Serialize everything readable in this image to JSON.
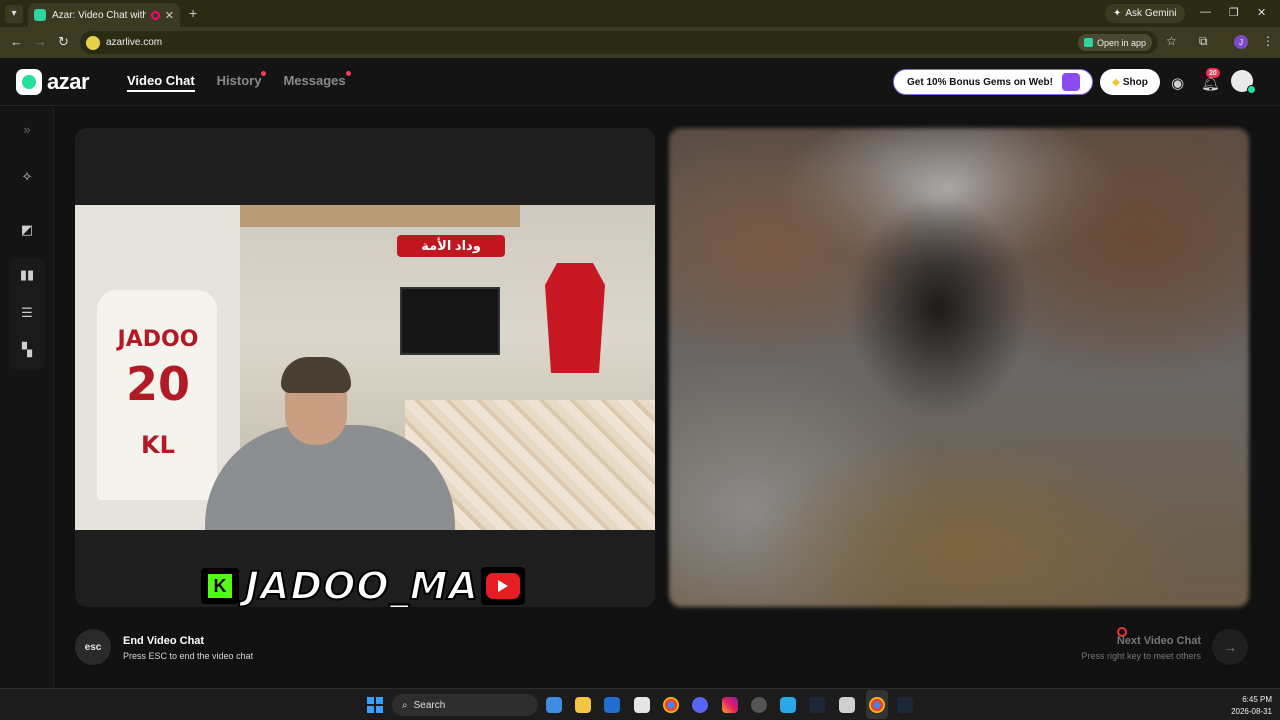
{
  "browser": {
    "tab_title": "Azar: Video Chat with New",
    "url": "azarlive.com",
    "ask_gemini": "Ask Gemini",
    "open_in_app": "Open in app",
    "profile_initial": "J"
  },
  "header": {
    "brand": "azar",
    "nav": [
      "Video Chat",
      "History",
      "Messages"
    ],
    "promo": "Get 10% Bonus Gems on Web!",
    "shop": "Shop",
    "notification_count": "20"
  },
  "video": {
    "overlay_name": "JADOO_MA",
    "jersey_name": "JADOO",
    "jersey_number": "20",
    "jersey_letters": "KL",
    "scarf_text": "وداد الأمة"
  },
  "controls": {
    "end_key": "esc",
    "end_title": "End Video Chat",
    "end_subtitle": "Press ESC to end the video chat",
    "next_title": "Next Video Chat",
    "next_subtitle": "Press right key to meet others"
  },
  "taskbar": {
    "search_label": "Search",
    "time": "6:45 PM",
    "date": "2026-08-31"
  },
  "colors": {
    "accent": "#21e29b",
    "notification_red": "#ff2d55"
  }
}
